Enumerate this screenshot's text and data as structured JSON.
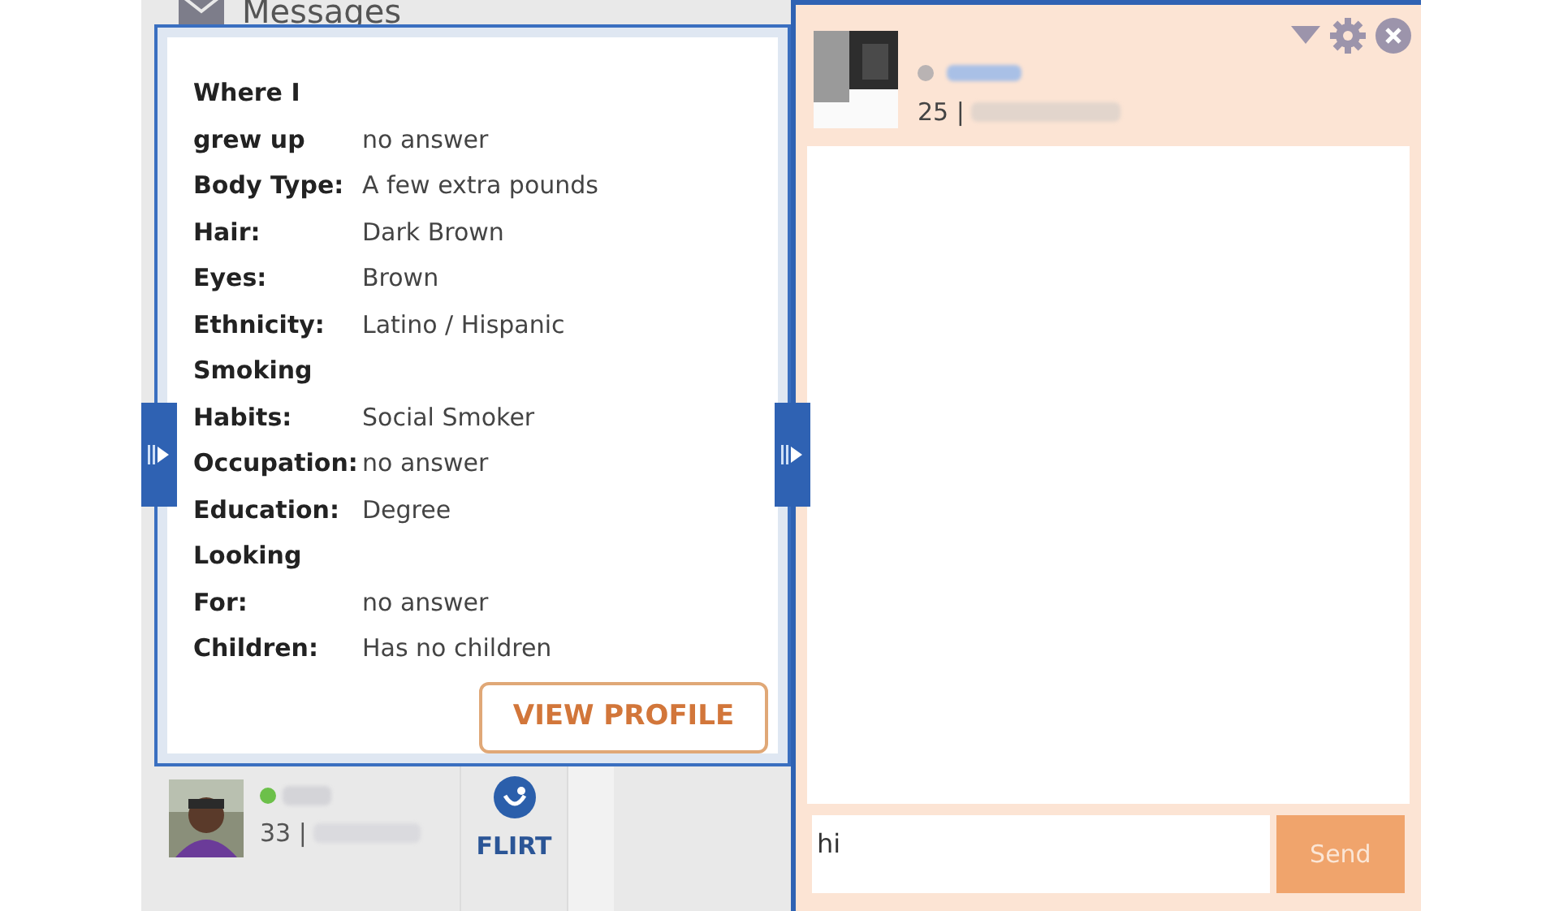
{
  "header": {
    "title": "Messages"
  },
  "profile_details": [
    {
      "label_lines": [
        "Where I",
        "grew up"
      ],
      "value": "no answer"
    },
    {
      "label_lines": [
        "Body Type:"
      ],
      "value": "A few extra pounds"
    },
    {
      "label_lines": [
        "Hair:"
      ],
      "value": "Dark Brown"
    },
    {
      "label_lines": [
        "Eyes:"
      ],
      "value": "Brown"
    },
    {
      "label_lines": [
        "Ethnicity:"
      ],
      "value": "Latino / Hispanic"
    },
    {
      "label_lines": [
        "Smoking",
        "Habits:"
      ],
      "value": "Social Smoker"
    },
    {
      "label_lines": [
        "Occupation:"
      ],
      "value": "no answer"
    },
    {
      "label_lines": [
        "Education:"
      ],
      "value": "Degree"
    },
    {
      "label_lines": [
        "Looking",
        "For:"
      ],
      "value": "no answer"
    },
    {
      "label_lines": [
        "Children:"
      ],
      "value": "Has no children"
    }
  ],
  "view_profile_button": "VIEW PROFILE",
  "conversation_item": {
    "online": true,
    "age": "33 |",
    "action": "FLIRT"
  },
  "chat": {
    "online": false,
    "age": "25 |",
    "message_input": "hi",
    "send_button": "Send"
  }
}
